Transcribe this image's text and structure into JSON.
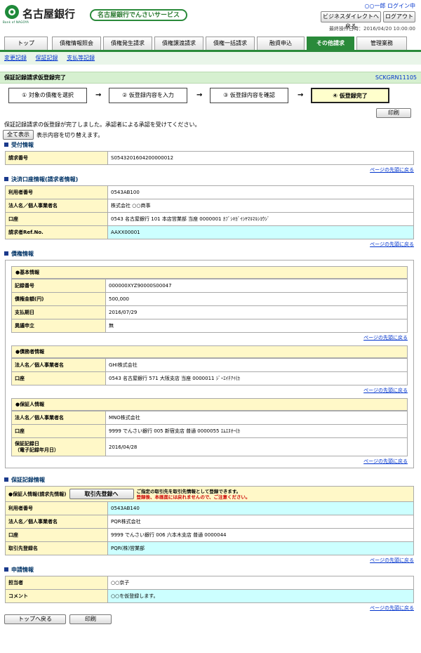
{
  "header": {
    "bank_name": "名古屋銀行",
    "logo_sub": "Bank of NAGOYA",
    "service": "名古屋銀行でんさいサービス",
    "user": "○○一郎 ログイン中",
    "btn_direct": "ビジネスダイレクトへ戻る",
    "btn_logout": "ログアウト",
    "last_op": "最終操作日時：2016/04/20 10:00:00"
  },
  "tabs": [
    "トップ",
    "債権情報照会",
    "債権発生請求",
    "債権譲渡請求",
    "債権一括請求",
    "融資申込",
    "その他請求",
    "管理業務"
  ],
  "subnav": [
    "変更記録",
    "保証記録",
    "支払等記録"
  ],
  "page": {
    "title": "保証記録請求仮登録完了",
    "code": "SCKGRN11105"
  },
  "steps": [
    "① 対象の債権を選択",
    "② 仮登録内容を入力",
    "③ 仮登録内容を確認",
    "④ 仮登録完了"
  ],
  "print_label": "印刷",
  "message": "保証記録請求の仮登録が完了しました。承認者による承認を受けてください。",
  "show_all": {
    "label": "全て表示",
    "desc": "表示内容を切り替えます。"
  },
  "to_top": "ページの先頭に戻る",
  "reception": {
    "heading": "受付情報",
    "key": "請求番号",
    "value": "S0543201604200000012"
  },
  "settlement": {
    "heading": "決済口座情報(請求者情報)",
    "rows": [
      {
        "k": "利用者番号",
        "v": "0543AB100"
      },
      {
        "k": "法人名／個人事業者名",
        "v": "株式会社 ○○商事"
      },
      {
        "k": "口座",
        "v": "0543 名古屋銀行 101 本店営業部 当座 0000001 ｶﾌﾞｼｷｶﾞｲｼﾔﾏﾙﾏﾙｼﾖｳｼﾞ"
      },
      {
        "k": "請求者Ref.No.",
        "v": "AAXX00001"
      }
    ]
  },
  "claim": {
    "heading": "債権情報",
    "basic": {
      "title": "●基本情報",
      "rows": [
        {
          "k": "記録番号",
          "v": "000000XYZ90000S00047"
        },
        {
          "k": "債権金額(円)",
          "v": "500,000"
        },
        {
          "k": "支払期日",
          "v": "2016/07/29"
        },
        {
          "k": "異議申立",
          "v": "無"
        }
      ]
    },
    "debtor": {
      "title": "●債務者情報",
      "rows": [
        {
          "k": "法人名／個人事業者名",
          "v": "GHI株式会社"
        },
        {
          "k": "口座",
          "v": "0543 名古屋銀行 571 大阪支店 当座 0000011 ｼﾞｰｴｲﾁｱｲ(ｶ"
        }
      ]
    },
    "guarantor": {
      "title": "●保証人情報",
      "rows": [
        {
          "k": "法人名／個人事業者名",
          "v": "MNO株式会社"
        },
        {
          "k": "口座",
          "v": "9999 でんさい銀行 005 新宿支店 普通 0000055 ｴﾑｴﾇｵｰ(ｶ"
        },
        {
          "k": "保証記録日\n（電子記録年月日）",
          "v": "2016/04/28"
        }
      ]
    }
  },
  "guarantee": {
    "heading": "保証記録情報",
    "sub_title": "●保証人情報(請求先情報)",
    "register_btn": "取引先登録へ",
    "note1": "ご指定の取引先を取引先情報として登録できます。",
    "note2": "登録後、本画面には戻れませんので、ご注意ください。",
    "rows": [
      {
        "k": "利用者番号",
        "v": "0543AB140"
      },
      {
        "k": "法人名／個人事業者名",
        "v": "PQR株式会社"
      },
      {
        "k": "口座",
        "v": "9999 でんさい銀行 006 六本木支店 普通 0000044"
      },
      {
        "k": "取引先登録名",
        "v": "PQR(株)営業部"
      }
    ]
  },
  "apply": {
    "heading": "申請情報",
    "rows": [
      {
        "k": "担当者",
        "v": "○○京子"
      },
      {
        "k": "コメント",
        "v": "○○を仮登録します。"
      }
    ]
  },
  "footer": {
    "back_top": "トップへ戻る",
    "print": "印刷"
  },
  "colors": {
    "accent": "#2a8a3a",
    "key_bg": "#fff8c8",
    "highlight_bg": "#ccffff",
    "warning": "#cc0000"
  }
}
